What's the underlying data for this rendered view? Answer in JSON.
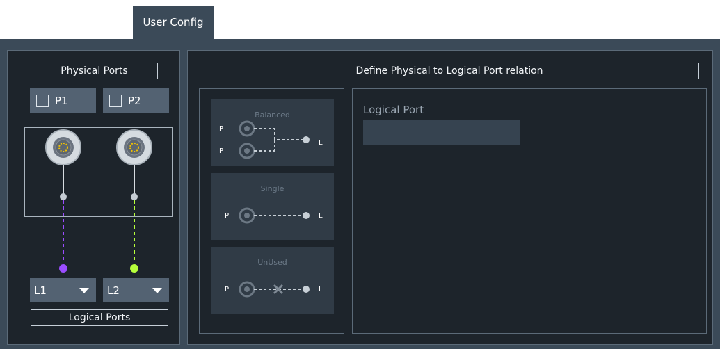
{
  "tab": {
    "label": "User Config"
  },
  "physical": {
    "header": "Physical Ports",
    "ports": [
      {
        "label": "P1",
        "checked": false
      },
      {
        "label": "P2",
        "checked": false
      }
    ],
    "line_colors": [
      "#9b4dff",
      "#b6ff3b"
    ]
  },
  "logical": {
    "footer": "Logical Ports",
    "selects": [
      {
        "value": "L1"
      },
      {
        "value": "L2"
      }
    ]
  },
  "relation": {
    "header": "Define Physical to Logical Port relation",
    "modes": [
      {
        "title": "Balanced",
        "p_label": "P",
        "l_label": "L"
      },
      {
        "title": "Single",
        "p_label": "P",
        "l_label": "L"
      },
      {
        "title": "UnUsed",
        "p_label": "P",
        "l_label": "L"
      }
    ],
    "logical_port_label": "Logical Port",
    "logical_port_value": ""
  }
}
